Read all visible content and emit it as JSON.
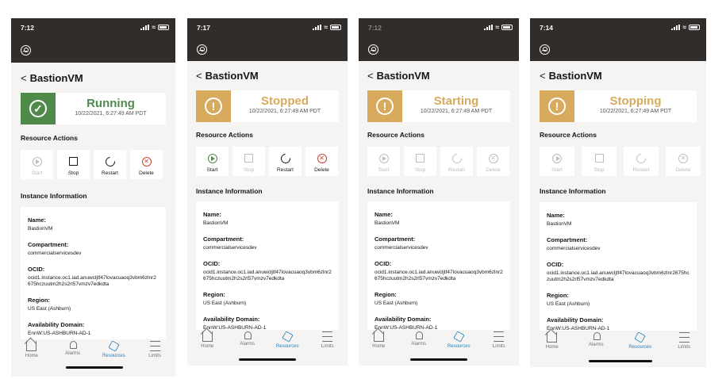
{
  "colors": {
    "header_bg": "#312d2a",
    "running": "#508a4b",
    "transition": "#d7aa5d",
    "stopped_text": "#d7aa5d",
    "active_tab": "#227ebd",
    "delete_red": "#c74634"
  },
  "common": {
    "instance_name": "BastionVM",
    "back_icon": "chevron-left-icon",
    "resource_actions_title": "Resource Actions",
    "instance_info_title": "Instance Information",
    "timestamp": "10/22/2021, 6:27:49 AM PDT",
    "actions": {
      "start": "Start",
      "stop": "Stop",
      "restart": "Restart",
      "delete": "Delete"
    },
    "info": {
      "name_label": "Name:",
      "name_value": "BastionVM",
      "compartment_label": "Compartment:",
      "compartment_value": "commercialservicesdev",
      "ocid_label": "OCID:",
      "ocid_value": "ocid1.instance.oc1.iad.anuwcljtf47lovacuaoq3vbm6zlnr2675hczuutm2h2s2rl57vmzv7edkdta",
      "region_label": "Region:",
      "region_value": "US East (Ashburn)",
      "ad_label": "Availability Domain:",
      "ad_value": "EnnW:US-ASHBURN-AD-1"
    },
    "tabs": {
      "home": "Home",
      "alarms": "Alarms",
      "resources": "Resources",
      "limits": "Limits"
    }
  },
  "screens": [
    {
      "time": "7:12",
      "state": "Running",
      "state_color": "#508a4b",
      "icon": "check-circle-icon"
    },
    {
      "time": "7:17",
      "state": "Stopped",
      "state_color": "#d7aa5d",
      "icon": "exclamation-circle-icon"
    },
    {
      "time": "7:12",
      "state": "Starting",
      "state_color": "#d7aa5d",
      "icon": "exclamation-circle-icon"
    },
    {
      "time": "7:14",
      "state": "Stopping",
      "state_color": "#d7aa5d",
      "icon": "exclamation-circle-icon"
    }
  ]
}
